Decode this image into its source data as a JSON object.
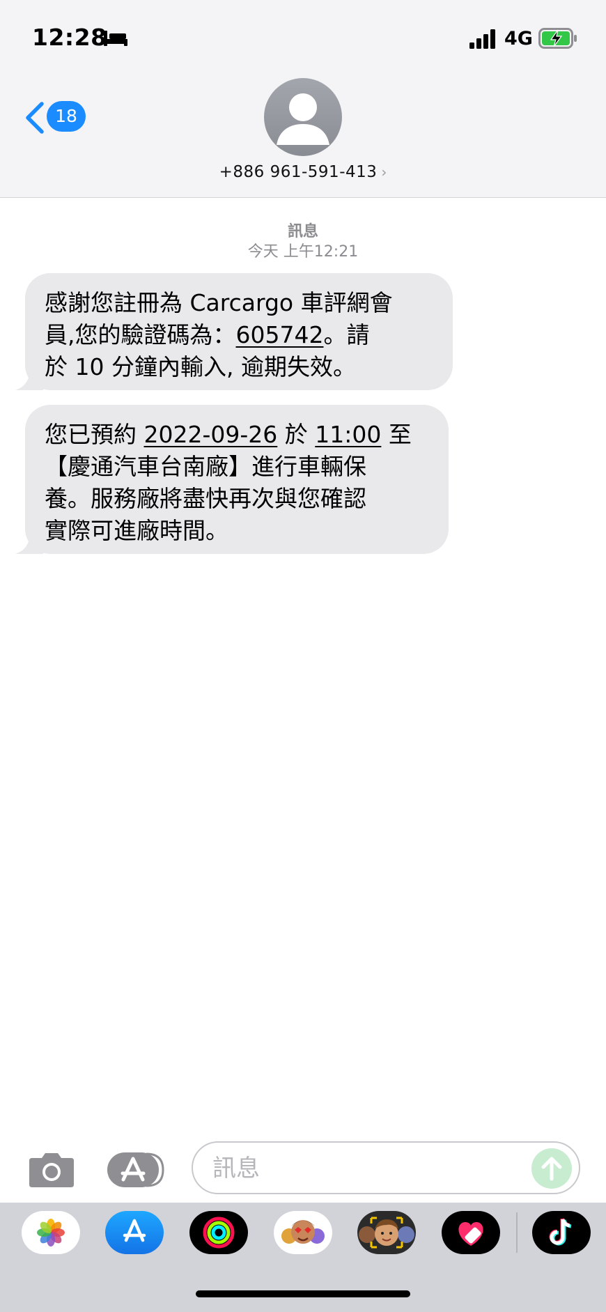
{
  "status_bar": {
    "time": "12:28",
    "network": "4G",
    "icons": [
      "bed-icon",
      "cellular-signal-icon",
      "battery-charging-icon"
    ]
  },
  "header": {
    "back_badge_count": "18",
    "contact_number": "+886 961-591-413",
    "chevron": "›"
  },
  "thread": {
    "label": "訊息",
    "timestamp": "今天 上午12:21",
    "messages": [
      {
        "line1": "感謝您註冊為 Carcargo 車評網會",
        "line2_a": "員,您的驗證碼為：",
        "code": "605742",
        "line2_b": "。請",
        "line3": "於 10 分鐘內輸入, 逾期失效。"
      },
      {
        "line1_a": "您已預約 ",
        "date": "2022-09-26",
        "line1_b": " 於 ",
        "time": "11:00",
        "line1_c": " 至",
        "line2": "【慶通汽車台南廠】進行車輛保",
        "line3": "養。服務廠將盡快再次與您確認",
        "line4": "實際可進廠時間。"
      }
    ]
  },
  "composer": {
    "placeholder": "訊息",
    "value": ""
  },
  "app_drawer": {
    "apps": [
      "photos-icon",
      "app-store-icon",
      "activity-icon",
      "memoji-stickers-icon",
      "memoji-icon",
      "heart-app-icon",
      "tiktok-icon"
    ]
  },
  "colors": {
    "accent": "#1a8cff",
    "bubble": "#e9e9eb",
    "header_bg": "#f4f4f6",
    "drawer_bg": "#d1d3d9",
    "send_disabled": "#c7ecd0"
  }
}
